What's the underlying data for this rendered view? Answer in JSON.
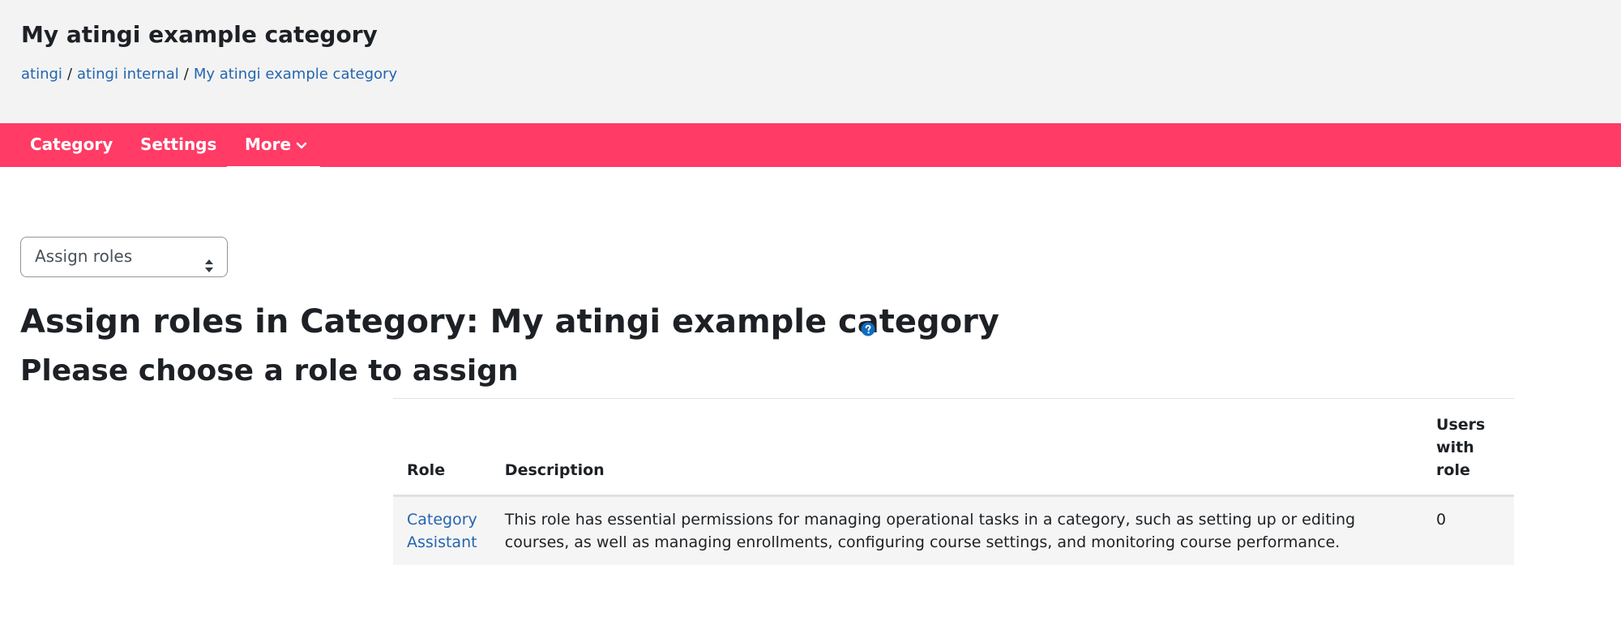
{
  "header": {
    "title": "My atingi example category",
    "breadcrumb": [
      {
        "label": "atingi"
      },
      {
        "label": "atingi internal"
      },
      {
        "label": "My atingi example category"
      }
    ],
    "breadcrumb_separator": "/"
  },
  "nav": {
    "tabs": [
      {
        "label": "Category"
      },
      {
        "label": "Settings"
      },
      {
        "label": "More",
        "icon": "chevron-down-icon",
        "active": true
      }
    ],
    "background_color": "#ff3b66"
  },
  "select": {
    "selected_value": "Assign roles",
    "icon": "sort-arrows-icon"
  },
  "main": {
    "heading": "Assign roles in Category: My atingi example category",
    "help_icon": "question-circle-icon",
    "subheading": "Please choose a role to assign"
  },
  "table": {
    "headers": [
      "Role",
      "Description",
      "Users with role"
    ],
    "rows": [
      {
        "role": "Category Assistant",
        "description": "This role has essential permissions for managing operational tasks in a category, such as setting up or editing courses, as well as managing enrollments, configuring course settings, and monitoring course performance.",
        "users": "0"
      }
    ]
  },
  "colors": {
    "link": "#2465b0",
    "help_icon": "#0f6cbf"
  }
}
